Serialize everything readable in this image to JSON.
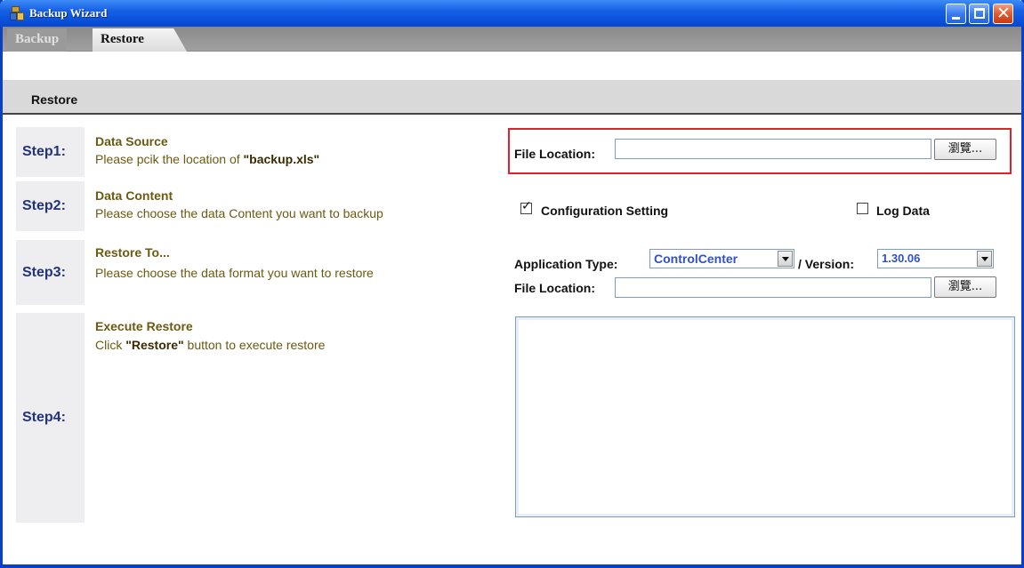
{
  "window": {
    "title": "Backup Wizard"
  },
  "tabs": [
    {
      "label": "Backup"
    },
    {
      "label": "Restore"
    }
  ],
  "subheader": {
    "label": "Restore"
  },
  "steps": [
    {
      "label": "Step1:",
      "title": "Data Source",
      "desc_pre": "Please pcik the location of ",
      "desc_bold": "\"backup.xls\"",
      "desc_post": ""
    },
    {
      "label": "Step2:",
      "title": "Data Content",
      "desc_pre": "Please choose the data Content you want to backup",
      "desc_bold": "",
      "desc_post": ""
    },
    {
      "label": "Step3:",
      "title": "Restore To...",
      "desc_pre": "Please choose the data format you want to restore",
      "desc_bold": "",
      "desc_post": ""
    },
    {
      "label": "Step4:",
      "title": "Execute Restore",
      "desc_pre": "Click ",
      "desc_bold": "\"Restore\"",
      "desc_post": " button to execute restore"
    }
  ],
  "source": {
    "file_location_label": "File Location:",
    "file_location_value": "",
    "browse_label": "瀏覽..."
  },
  "content": {
    "config_label": "Configuration Setting",
    "config_checked": true,
    "log_label": "Log Data",
    "log_checked": false
  },
  "restore_to": {
    "app_type_label": "Application Type:",
    "app_type_value": "ControlCenter",
    "version_label": "/ Version:",
    "version_value": "1.30.06",
    "file_location_label": "File Location:",
    "file_location_value": "",
    "browse_label": "瀏覽..."
  },
  "execute": {
    "log_text": ""
  }
}
